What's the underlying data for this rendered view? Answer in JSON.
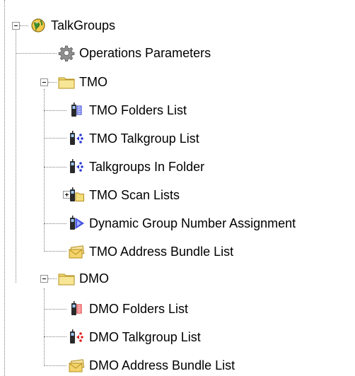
{
  "tree": {
    "root": {
      "label": "TalkGroups",
      "icon": "talkgroups-globe-icon",
      "expanded": true,
      "children": {
        "operations": {
          "label": "Operations Parameters",
          "icon": "gear-icon"
        },
        "tmo": {
          "label": "TMO",
          "icon": "folder-icon",
          "expanded": true,
          "items": [
            {
              "label": "TMO Folders List",
              "icon": "radio-folder-icon"
            },
            {
              "label": "TMO Talkgroup List",
              "icon": "radio-talkgroup-icon"
            },
            {
              "label": "Talkgroups In Folder",
              "icon": "radio-talkgroup-icon"
            },
            {
              "label": "TMO Scan Lists",
              "icon": "radio-scan-icon",
              "collapsed": true
            },
            {
              "label": "Dynamic Group Number Assignment",
              "icon": "radio-dgna-icon"
            },
            {
              "label": "TMO Address Bundle List",
              "icon": "envelope-bundle-icon"
            }
          ]
        },
        "dmo": {
          "label": "DMO",
          "icon": "folder-icon",
          "expanded": true,
          "items": [
            {
              "label": "DMO Folders List",
              "icon": "radio-folder-icon"
            },
            {
              "label": "DMO Talkgroup List",
              "icon": "radio-talkgroup-icon"
            },
            {
              "label": "DMO Address Bundle List",
              "icon": "envelope-bundle-icon"
            }
          ]
        }
      }
    }
  },
  "colors": {
    "tmo_accent": "#2e3bd6",
    "dmo_accent": "#e02020",
    "folder_fill": "#f3dd7a",
    "folder_stroke": "#b58f1e",
    "connector": "#7f7f7f"
  }
}
